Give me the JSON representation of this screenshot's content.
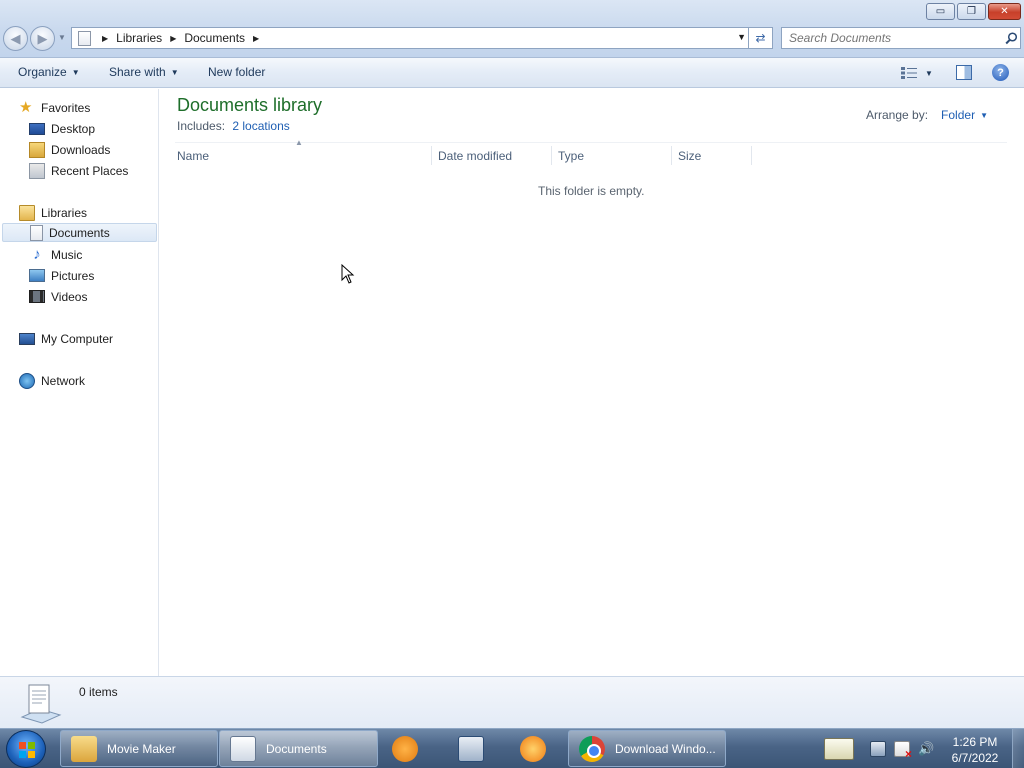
{
  "window": {
    "controls": {
      "minimize": "▭",
      "maximize": "❐",
      "close": "✕"
    }
  },
  "address": {
    "crumbs": [
      "Libraries",
      "Documents"
    ],
    "icon": "document-library-icon"
  },
  "search": {
    "placeholder": "Search Documents"
  },
  "toolbar": {
    "organize": "Organize",
    "share_with": "Share with",
    "new_folder": "New folder",
    "help": "?"
  },
  "nav": {
    "favorites": {
      "label": "Favorites",
      "items": [
        "Desktop",
        "Downloads",
        "Recent Places"
      ]
    },
    "libraries": {
      "label": "Libraries",
      "items": [
        "Documents",
        "Music",
        "Pictures",
        "Videos"
      ],
      "selected": "Documents"
    },
    "computer": "My Computer",
    "network": "Network"
  },
  "content": {
    "title": "Documents library",
    "includes_label": "Includes:",
    "includes_link": "2 locations",
    "arrange_label": "Arrange by:",
    "arrange_value": "Folder",
    "columns": [
      "Name",
      "Date modified",
      "Type",
      "Size"
    ],
    "empty_message": "This folder is empty."
  },
  "details": {
    "item_count": "0 items"
  },
  "taskbar": {
    "tasks": [
      {
        "label": "Movie Maker",
        "icon": "folder-icon"
      },
      {
        "label": "Documents",
        "icon": "documents-library-icon"
      },
      {
        "label": "",
        "icon": "media-player-icon"
      },
      {
        "label": "",
        "icon": "on-screen-keyboard-icon"
      },
      {
        "label": "",
        "icon": "avast-icon"
      },
      {
        "label": "Download Windo...",
        "icon": "chrome-icon"
      }
    ],
    "clock": {
      "time": "1:26 PM",
      "date": "6/7/2022"
    }
  },
  "colors": {
    "library_title": "#1e6e2a",
    "link": "#1f5fb3",
    "taskbar": "#4a6486"
  }
}
